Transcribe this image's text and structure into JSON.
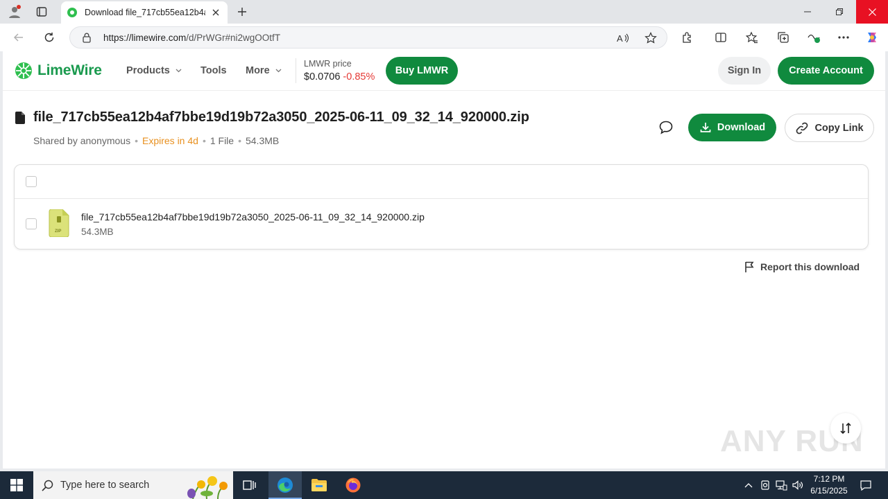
{
  "browser": {
    "tab_title": "Download file_717cb55ea12b4af7",
    "url_host": "https://limewire.com",
    "url_path": "/d/PrWGr#ni2wgOOtfT"
  },
  "site": {
    "logo_text": "LimeWire",
    "menu": [
      {
        "label": "Products"
      },
      {
        "label": "Tools"
      },
      {
        "label": "More"
      }
    ],
    "price_label": "LMWR price",
    "price_value": "$0.0706",
    "price_change": "-0.85%",
    "buy_label": "Buy LMWR",
    "signin_label": "Sign In",
    "create_label": "Create Account"
  },
  "file": {
    "title": "file_717cb55ea12b4af7bbe19d19b72a3050_2025-06-11_09_32_14_920000.zip",
    "shared_by": "Shared by anonymous",
    "expires": "Expires in 4d",
    "file_count": "1 File",
    "size": "54.3MB",
    "download_label": "Download",
    "copy_label": "Copy Link",
    "row_name": "file_717cb55ea12b4af7bbe19d19b72a3050_2025-06-11_09_32_14_920000.zip",
    "row_size": "54.3MB",
    "zip_tag": "ZIP",
    "report_label": "Report this download"
  },
  "watermark": "ANY RUN",
  "taskbar": {
    "search_placeholder": "Type here to search",
    "time": "7:12 PM",
    "date": "6/15/2025"
  },
  "colors": {
    "brand_green": "#108a3e",
    "expires_orange": "#e8901f",
    "negative_red": "#e53935"
  }
}
